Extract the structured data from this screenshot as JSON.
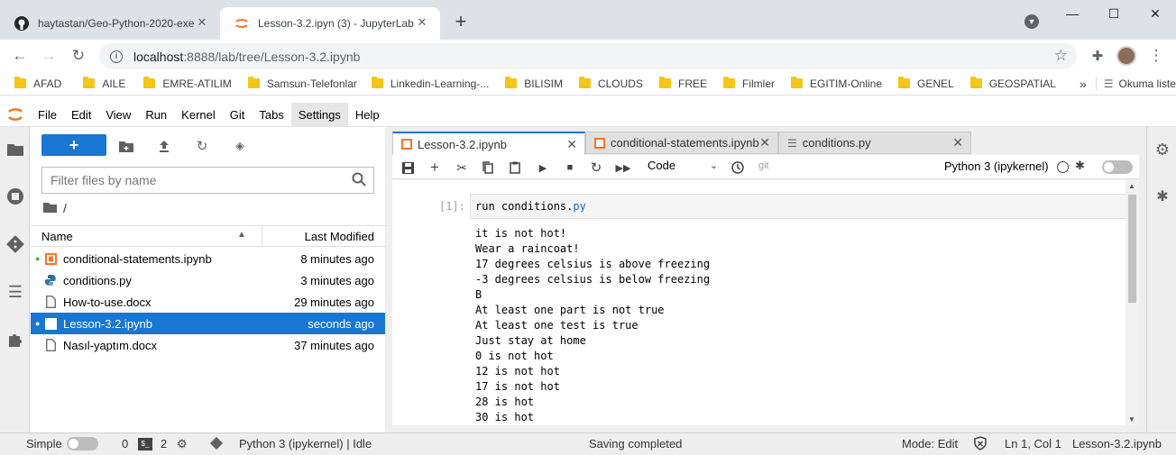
{
  "browser": {
    "tabs": [
      {
        "title": "haytastan/Geo-Python-2020-exe",
        "icon": "github-icon"
      },
      {
        "title": "Lesson-3.2.ipyn (3) - JupyterLab",
        "icon": "jupyter-icon"
      }
    ],
    "url_host": "localhost",
    "url_path": ":8888/lab/tree/Lesson-3.2.ipynb",
    "bookmarks": [
      "AFAD",
      "AILE",
      "EMRE-ATILIM",
      "Samsun-Telefonlar",
      "Linkedin-Learning-...",
      "BILISIM",
      "CLOUDS",
      "FREE",
      "Filmler",
      "EGITIM-Online",
      "GENEL",
      "GEOSPATIAL"
    ],
    "more_bookmarks": "»",
    "reading_list": "Okuma listesi"
  },
  "menu": [
    "File",
    "Edit",
    "View",
    "Run",
    "Kernel",
    "Git",
    "Tabs",
    "Settings",
    "Help"
  ],
  "filebrowser": {
    "filter_placeholder": "Filter files by name",
    "path": "/",
    "col_name": "Name",
    "col_modified": "Last Modified",
    "files": [
      {
        "name": "conditional-statements.ipynb",
        "modified": "8 minutes ago",
        "type": "notebook",
        "running": true,
        "selected": false
      },
      {
        "name": "conditions.py",
        "modified": "3 minutes ago",
        "type": "python",
        "running": false,
        "selected": false
      },
      {
        "name": "How-to-use.docx",
        "modified": "29 minutes ago",
        "type": "file",
        "running": false,
        "selected": false
      },
      {
        "name": "Lesson-3.2.ipynb",
        "modified": "seconds ago",
        "type": "notebook",
        "running": true,
        "selected": true
      },
      {
        "name": "Nasıl-yaptım.docx",
        "modified": "37 minutes ago",
        "type": "file",
        "running": false,
        "selected": false
      }
    ]
  },
  "doc_tabs": [
    {
      "title": "Lesson-3.2.ipynb"
    },
    {
      "title": "conditional-statements.ipynb"
    },
    {
      "title": "conditions.py"
    }
  ],
  "notebook": {
    "cell_type": "Code",
    "git_label": "git",
    "kernel": "Python 3 (ipykernel)",
    "prompt": "[1]:",
    "input_code": "run conditions.",
    "input_ext": "py",
    "output": [
      "it is not hot!",
      "Wear a raincoat!",
      "17 degrees celsius is above freezing",
      "-3 degrees celsius is below freezing",
      "B",
      "At least one part is not true",
      "At least one test is true",
      "Just stay at home",
      "0 is not hot",
      "12 is not hot",
      "17 is not hot",
      "28 is hot",
      "30 is hot"
    ]
  },
  "status": {
    "simple_label": "Simple",
    "terminals": "0",
    "kernels": "2",
    "kernel_status": "Python 3 (ipykernel) | Idle",
    "message": "Saving completed",
    "mode": "Mode: Edit",
    "position": "Ln 1, Col 1",
    "filename": "Lesson-3.2.ipynb"
  }
}
